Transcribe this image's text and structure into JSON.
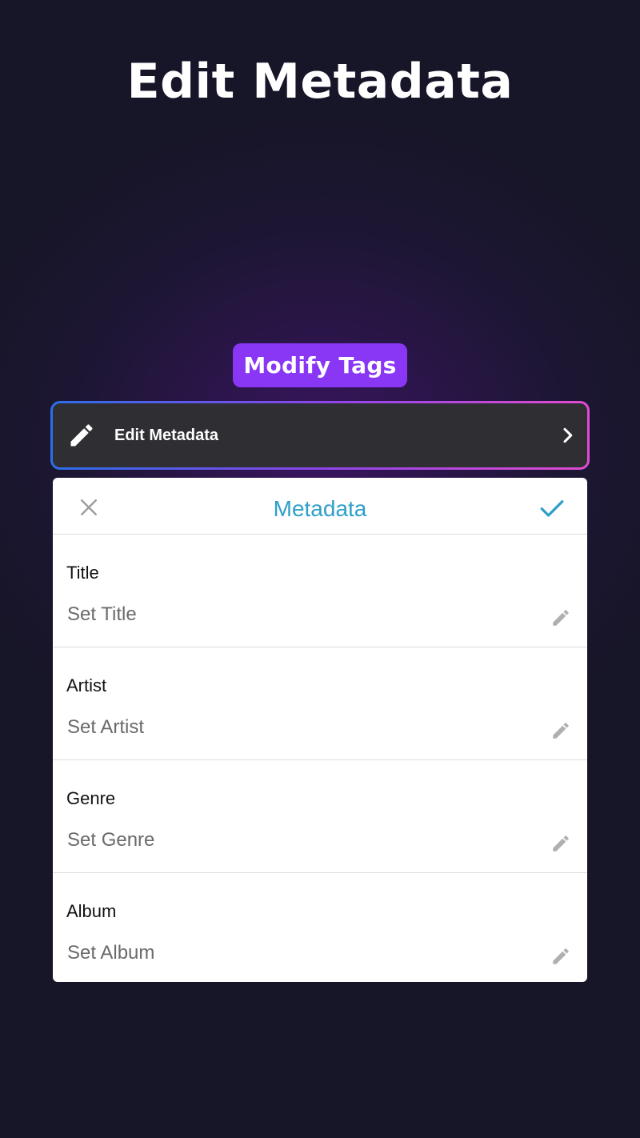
{
  "headline": "Edit Metadata",
  "pill_label": "Modify Tags",
  "menu_row": {
    "icon": "pencil-icon",
    "label": "Edit Metadata",
    "trailing_icon": "chevron-right-icon"
  },
  "dialog": {
    "title": "Metadata",
    "close_icon": "close-icon",
    "confirm_icon": "check-icon",
    "fields": [
      {
        "label": "Title",
        "placeholder": "Set Title",
        "value": ""
      },
      {
        "label": "Artist",
        "placeholder": "Set Artist",
        "value": ""
      },
      {
        "label": "Genre",
        "placeholder": "Set Genre",
        "value": ""
      },
      {
        "label": "Album",
        "placeholder": "Set Album",
        "value": ""
      }
    ]
  },
  "colors": {
    "background": "#1d1633",
    "glow": "#3a1560",
    "pill": "#8a37f5",
    "menu_row_bg": "#2f2e33",
    "border_gradient_start": "#2b6ee8",
    "border_gradient_end": "#e14bd1",
    "dialog_accent": "#2e9fc9",
    "close_icon": "#9e9e9e",
    "field_edit_icon": "#b0b0b0"
  }
}
